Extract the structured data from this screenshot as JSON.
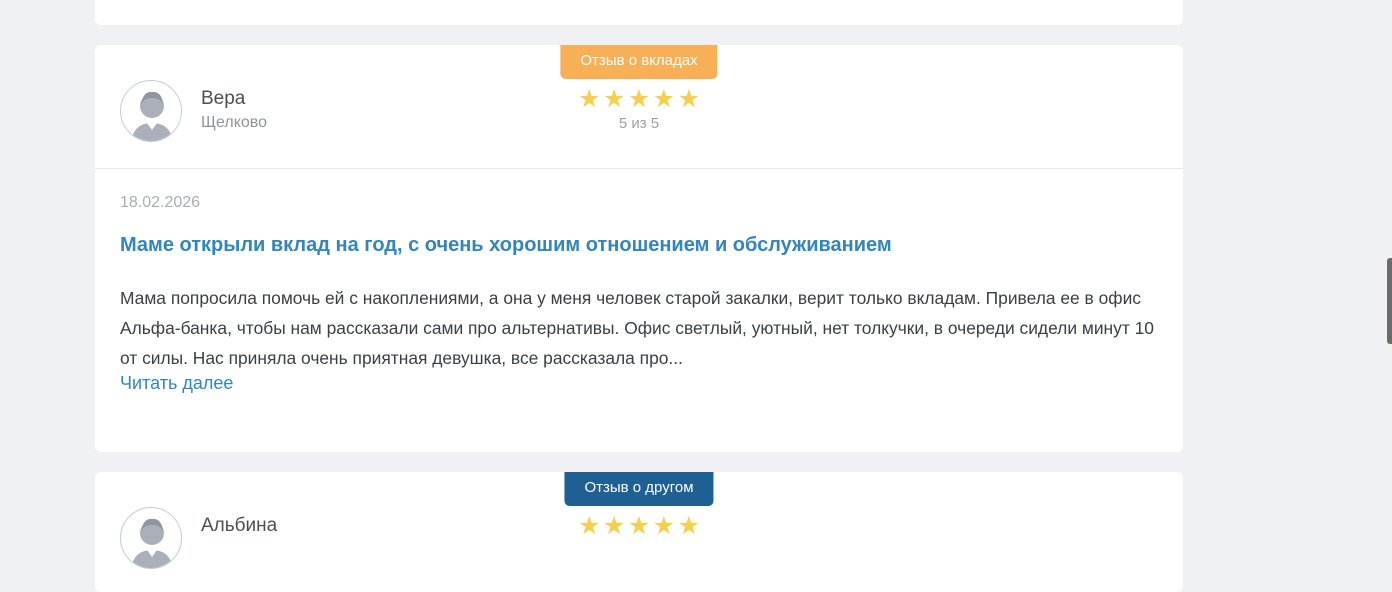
{
  "reviews": [
    {
      "badge": "Отзыв о вкладах",
      "badge_color": "#f8b056",
      "author": "Вера",
      "city": "Щелково",
      "stars": 5,
      "rating_text": "5 из 5",
      "date": "18.02.2026",
      "title": "Маме открыли вклад на год, с очень хорошим отношением и обслуживанием",
      "text": "Мама попросила помочь ей с накоплениями, а она у меня человек старой закалки, верит только вкладам. Привела ее в офис Альфа-банка, чтобы нам рассказали сами про альтернативы. Офис светлый, уютный, нет толкучки, в очереди сидели минут 10 от силы. Нас приняла очень приятная девушка, все рассказала про...",
      "read_more": "Читать далее"
    },
    {
      "badge": "Отзыв о другом",
      "badge_color": "#1e5f94",
      "author": "Альбина",
      "stars": 5
    }
  ],
  "colors": {
    "page_bg": "#eff1f4",
    "star": "#f6d04d",
    "link": "#2f86c0"
  },
  "icons": {
    "avatar": "user-avatar-icon",
    "star": "star-icon"
  }
}
